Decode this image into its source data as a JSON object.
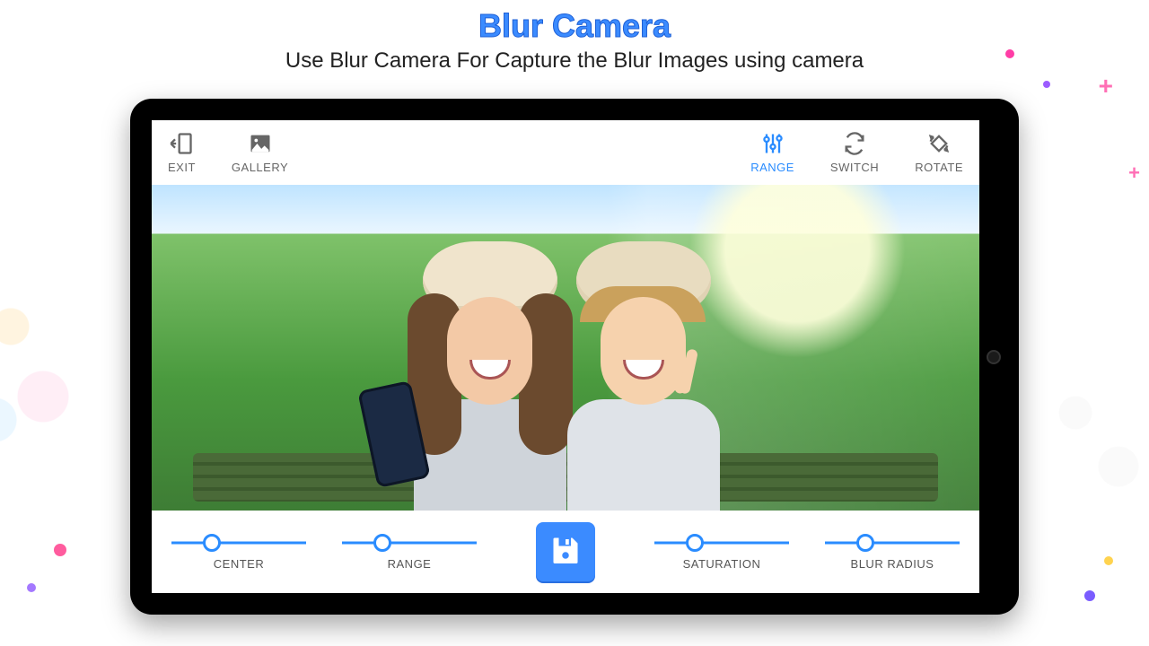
{
  "header": {
    "title": "Blur Camera",
    "subtitle": "Use Blur Camera For Capture the Blur Images using camera"
  },
  "topbar": {
    "exit": "EXIT",
    "gallery": "GALLERY",
    "range": "RANGE",
    "switch": "SWITCH",
    "rotate": "ROTATE",
    "active": "range"
  },
  "sliders": {
    "center": {
      "label": "CENTER",
      "position": 30
    },
    "range": {
      "label": "RANGE",
      "position": 30
    },
    "saturation": {
      "label": "SATURATION",
      "position": 30
    },
    "blur_radius": {
      "label": "BLUR RADIUS",
      "position": 30
    }
  },
  "icons": {
    "save": "save-icon"
  },
  "colors": {
    "accent": "#3b8bff",
    "slider": "#2a8cff",
    "text_muted": "#666666"
  }
}
